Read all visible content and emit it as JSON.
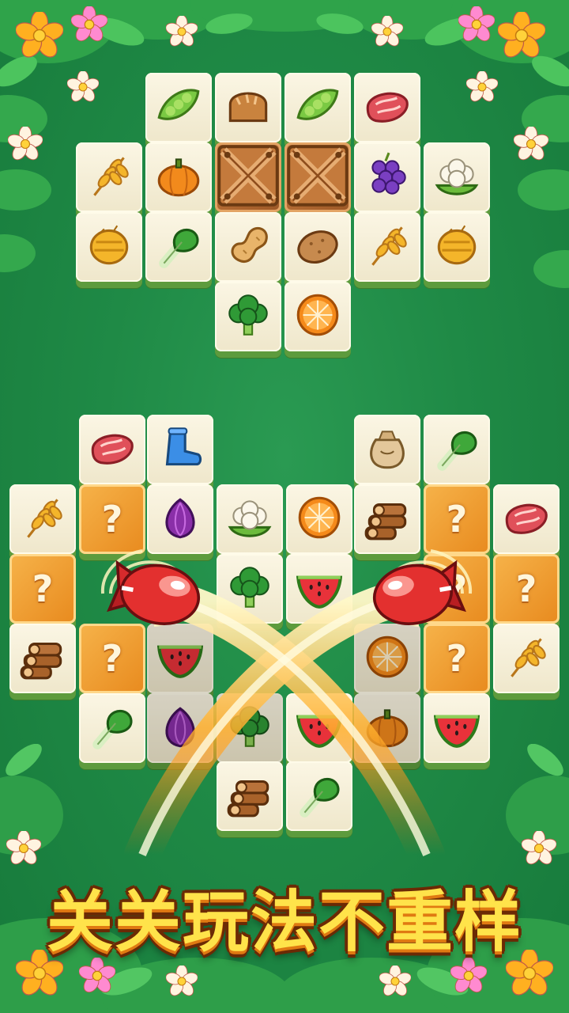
{
  "banner": {
    "text": "关关玩法不重样"
  },
  "board_top": [
    {
      "icon": "peas"
    },
    {
      "icon": "bread"
    },
    {
      "icon": "peas"
    },
    {
      "icon": "meat"
    },
    {
      "icon": "wheat"
    },
    {
      "icon": "pumpkin"
    },
    {
      "icon": "crate"
    },
    {
      "icon": "crate"
    },
    {
      "icon": "grapes"
    },
    {
      "icon": "cauliflower"
    },
    {
      "icon": "hay"
    },
    {
      "icon": "bokchoy"
    },
    {
      "icon": "peanut"
    },
    {
      "icon": "potato"
    },
    {
      "icon": "wheat"
    },
    {
      "icon": "hay"
    },
    {
      "icon": "broccoli"
    },
    {
      "icon": "orange"
    }
  ],
  "board_bottom": [
    {
      "icon": "meat"
    },
    {
      "icon": "boot"
    },
    {
      "icon": "sack"
    },
    {
      "icon": "bokchoy"
    },
    {
      "icon": "wheat"
    },
    {
      "icon": "mystery"
    },
    {
      "icon": "onion"
    },
    {
      "icon": "cauliflower"
    },
    {
      "icon": "orange"
    },
    {
      "icon": "logs"
    },
    {
      "icon": "mystery"
    },
    {
      "icon": "meat"
    },
    {
      "icon": "mystery"
    },
    {
      "icon": "broccoli"
    },
    {
      "icon": "watermelon"
    },
    {
      "icon": "mystery"
    },
    {
      "icon": "mystery"
    },
    {
      "icon": "logs"
    },
    {
      "icon": "mystery"
    },
    {
      "icon": "watermelon"
    },
    {
      "icon": "orange"
    },
    {
      "icon": "mystery"
    },
    {
      "icon": "wheat"
    },
    {
      "icon": "bokchoy"
    },
    {
      "icon": "onion"
    },
    {
      "icon": "broccoli"
    },
    {
      "icon": "watermelon"
    },
    {
      "icon": "pumpkin"
    },
    {
      "icon": "watermelon"
    },
    {
      "icon": "logs"
    },
    {
      "icon": "bokchoy"
    }
  ],
  "powerups": [
    {
      "icon": "rocket-left"
    },
    {
      "icon": "rocket-right"
    }
  ],
  "mystery_symbol": "?"
}
